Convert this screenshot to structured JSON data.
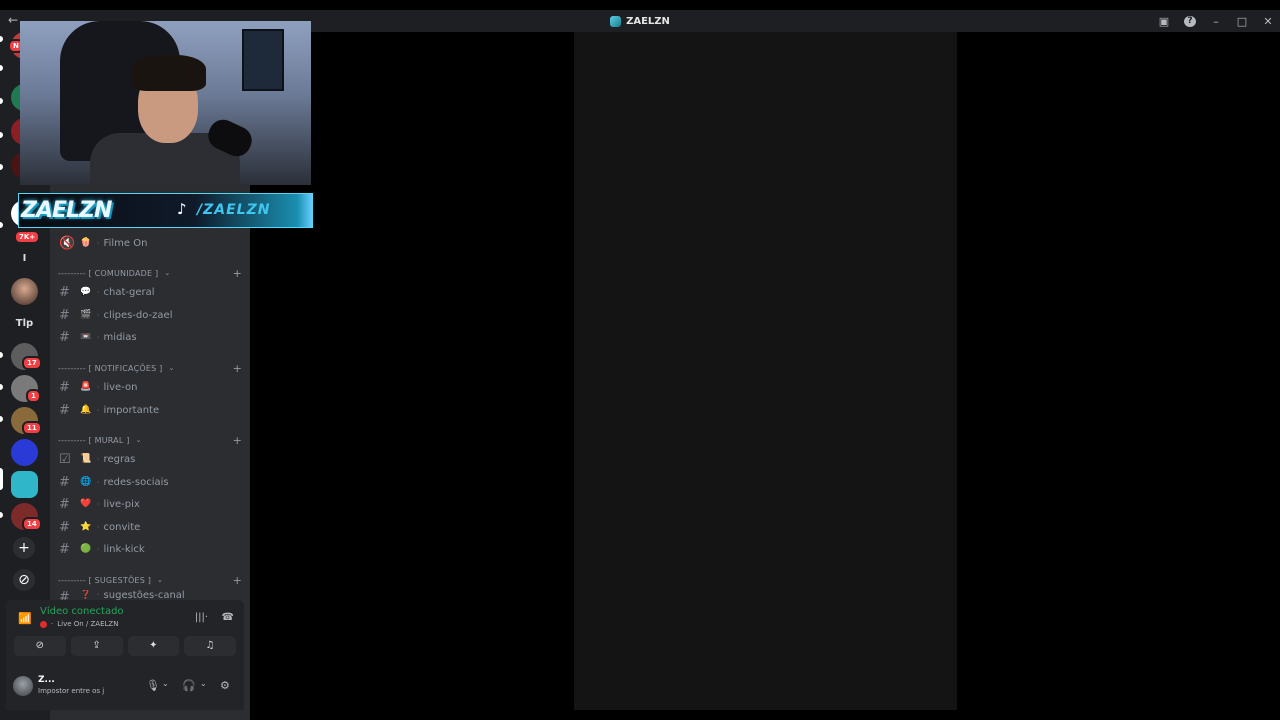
{
  "titlebar": {
    "title": "ZAELZN",
    "back_icon": "arrow-left-icon"
  },
  "rail": {
    "badges": [
      "N",
      "7K+",
      "17",
      "1",
      "11",
      "14"
    ],
    "text_servers": [
      "I",
      "Tlp"
    ]
  },
  "sidebar": {
    "voice_channel": {
      "emoji": "🍿",
      "name": "Filme On"
    },
    "categories": [
      {
        "label": "--------- [ COMUNIDADE ]",
        "channels": [
          {
            "emoji": "💬",
            "name": "chat-geral"
          },
          {
            "emoji": "🎬",
            "name": "clipes-do-zael"
          },
          {
            "emoji": "📼",
            "name": "midias"
          }
        ]
      },
      {
        "label": "--------- [ NOTIFICAÇÕES ]",
        "channels": [
          {
            "emoji": "🚨",
            "name": "live-on"
          },
          {
            "emoji": "🔔",
            "name": "importante"
          }
        ]
      },
      {
        "label": "--------- [ MURAL ]",
        "channels": [
          {
            "emoji": "📜",
            "name": "regras"
          },
          {
            "emoji": "🌐",
            "name": "redes-sociais"
          },
          {
            "emoji": "❤️",
            "name": "live-pix"
          },
          {
            "emoji": "⭐",
            "name": "convite"
          },
          {
            "emoji": "🟢",
            "name": "link-kick"
          }
        ]
      },
      {
        "label": "--------- [ SUGESTÕES ]",
        "channels": [
          {
            "emoji": "❓",
            "name": "sugestões-canal"
          }
        ]
      }
    ]
  },
  "voice": {
    "status": "Vídeo conectado",
    "channel": "Live On / ZAELZN"
  },
  "user": {
    "name": "Z...",
    "status": "Impostor entre os j"
  },
  "overlay": {
    "logo": "ZAELZN",
    "handle": "/ZAELZN"
  },
  "colors": {
    "accent_green": "#23a55a",
    "badge_red": "#f23f43",
    "banner_cyan": "#3ec6f0"
  }
}
